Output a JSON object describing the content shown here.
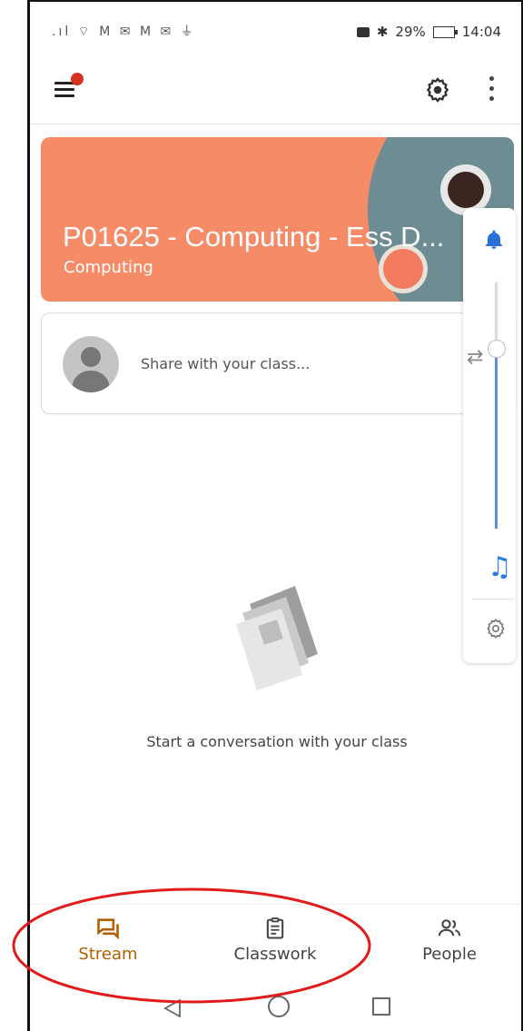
{
  "status_bar": {
    "left_icons": ".ıl ⌔ M ✉ M ✉ ⏚",
    "battery": "29%",
    "time": "14:04",
    "bluetooth": "✱"
  },
  "app_bar": {
    "menu_icon": "hamburger-icon",
    "settings_icon": "gear-icon",
    "more_icon": "more-vert-icon"
  },
  "class_banner": {
    "title": "P01625  -  Computing - Ess D...",
    "subtitle": "Computing",
    "color": "#f58b67"
  },
  "share": {
    "placeholder": "Share with your class..."
  },
  "empty_state": {
    "message": "Start a conversation with your class"
  },
  "bottom_nav": {
    "items": [
      {
        "label": "Stream",
        "icon": "stream-icon",
        "active": true
      },
      {
        "label": "Classwork",
        "icon": "classwork-icon",
        "active": false
      },
      {
        "label": "People",
        "icon": "people-icon",
        "active": false
      }
    ]
  },
  "colors": {
    "active": "#b06000",
    "annotation": "#e11b1b",
    "accent_blue": "#2a7de1"
  }
}
